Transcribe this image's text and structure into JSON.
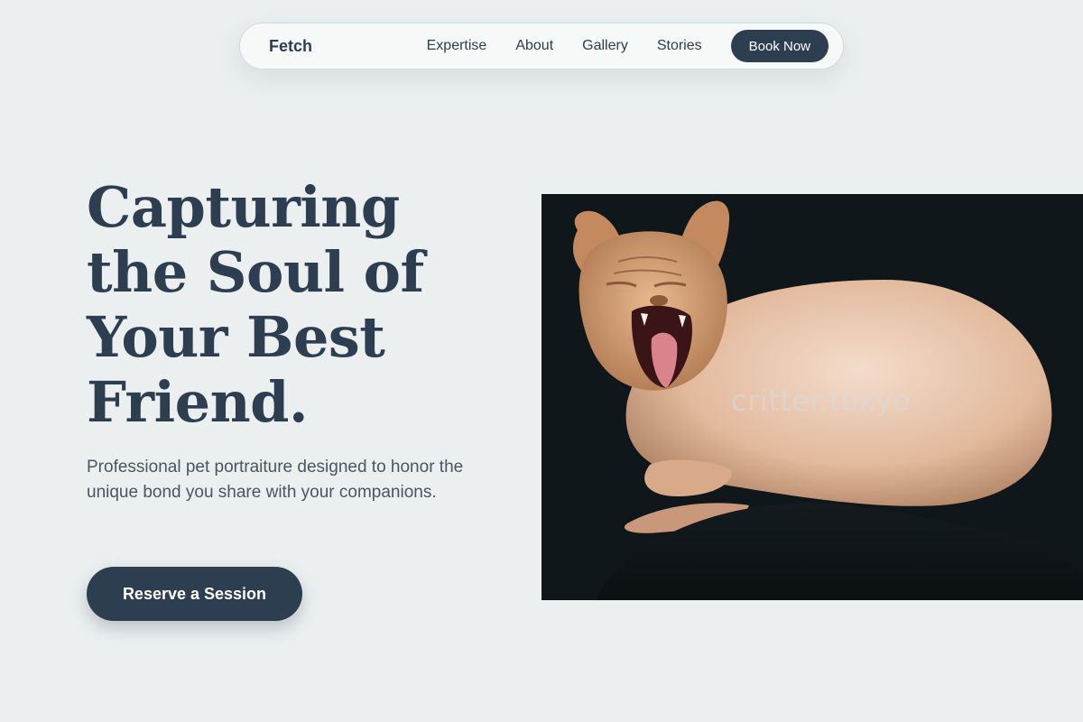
{
  "nav": {
    "brand": "Fetch",
    "links": [
      "Expertise",
      "About",
      "Gallery",
      "Stories"
    ],
    "cta": "Book Now"
  },
  "hero": {
    "title": "Capturing the Soul of Your Best Friend.",
    "subtitle": "Professional pet portraiture designed to honor the unique bond you share with your companions.",
    "cta": "Reserve a Session"
  },
  "photo": {
    "subject": "hairless-cat-photo",
    "watermark": "critter.tokyo"
  },
  "colors": {
    "background": "#ebeff0",
    "primary": "#2c3e50",
    "text_muted": "#4b5560"
  }
}
